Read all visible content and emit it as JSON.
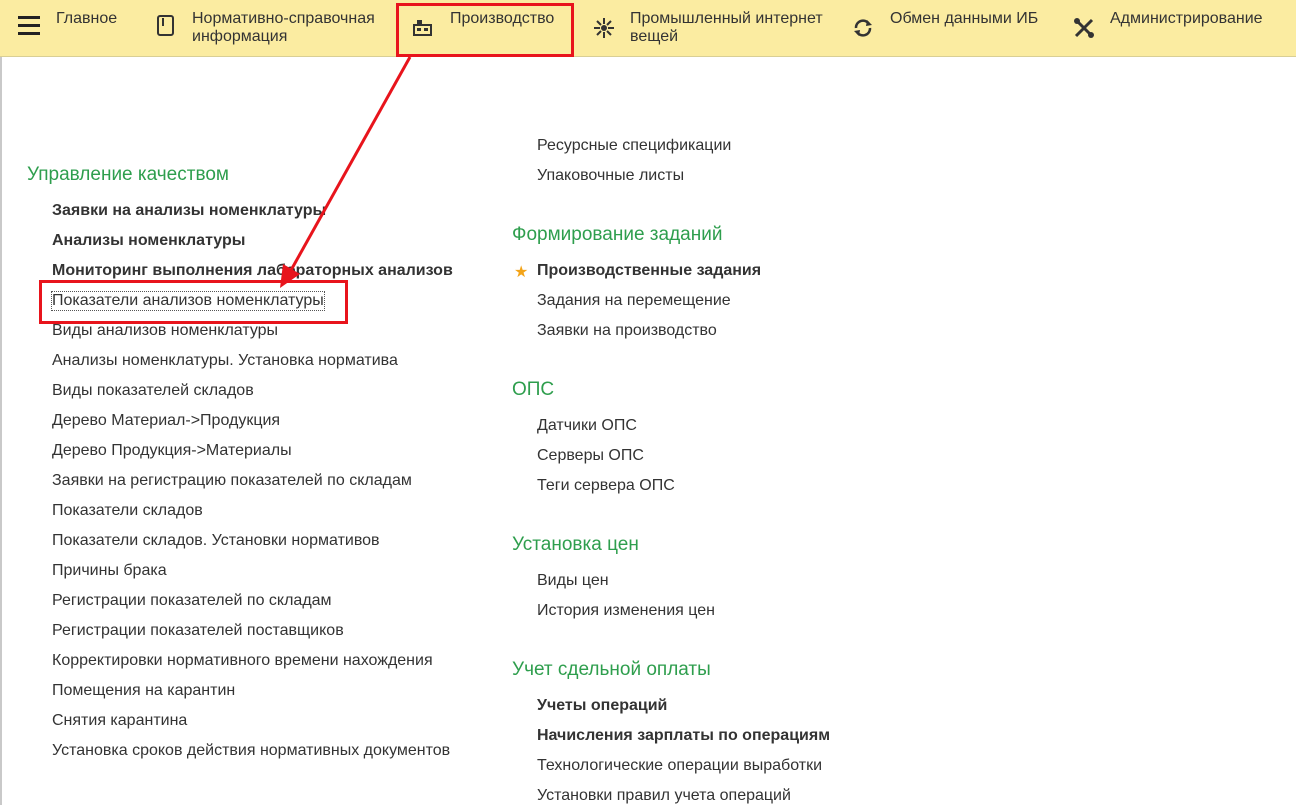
{
  "topbar": {
    "items": [
      {
        "label": "Главное",
        "icon": "hamburger-icon"
      },
      {
        "label": "Нормативно-справочная\nинформация",
        "icon": "book-icon"
      },
      {
        "label": "Производство",
        "icon": "factory-icon"
      },
      {
        "label": "Промышленный интернет\nвещей",
        "icon": "iot-icon"
      },
      {
        "label": "Обмен данными ИБ",
        "icon": "sync-icon"
      },
      {
        "label": "Администрирование",
        "icon": "tools-icon"
      }
    ]
  },
  "left": {
    "quality": {
      "title": "Управление качеством",
      "items": [
        "Заявки на анализы номенклатуры",
        "Анализы номенклатуры",
        "Мониторинг выполнения лабораторных анализов",
        "Показатели анализов номенклатуры",
        "Виды анализов номенклатуры",
        "Анализы номенклатуры. Установка норматива",
        "Виды показателей складов",
        "Дерево Материал->Продукция",
        "Дерево Продукция->Материалы",
        "Заявки на регистрацию показателей по складам",
        "Показатели складов",
        "Показатели складов. Установки нормативов",
        "Причины брака",
        "Регистрации показателей по складам",
        "Регистрации показателей поставщиков",
        "Корректировки нормативного времени нахождения",
        "Помещения на карантин",
        "Снятия карантина",
        "Установка сроков действия нормативных документов"
      ]
    }
  },
  "right": {
    "top_items": [
      "Ресурсные спецификации",
      "Упаковочные листы"
    ],
    "tasks": {
      "title": "Формирование заданий",
      "items": [
        "Производственные задания",
        "Задания на перемещение",
        "Заявки на производство"
      ]
    },
    "ops": {
      "title": "ОПС",
      "items": [
        "Датчики ОПС",
        "Серверы ОПС",
        "Теги сервера ОПС"
      ]
    },
    "prices": {
      "title": "Установка цен",
      "items": [
        "Виды цен",
        "История изменения цен"
      ]
    },
    "piecework": {
      "title": "Учет сдельной оплаты",
      "items": [
        "Учеты операций",
        "Начисления зарплаты по операциям",
        "Технологические операции выработки",
        "Установки правил учета операций"
      ]
    }
  },
  "colors": {
    "accent": "#2e9e4d",
    "highlight": "#e8141c",
    "topbar": "#fbeca1",
    "star": "#f3a419"
  }
}
